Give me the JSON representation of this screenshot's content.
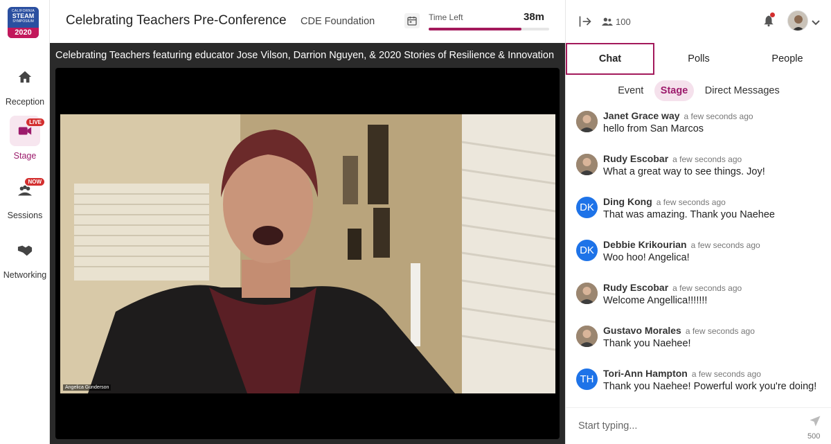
{
  "nav": {
    "logo": {
      "line1": "CALIFORNIA",
      "line2": "STEAM",
      "line3": "SYMPOSIUM",
      "year": "2020"
    },
    "items": [
      {
        "label": "Reception",
        "icon": "home-icon",
        "badge": ""
      },
      {
        "label": "Stage",
        "icon": "video-camera-icon",
        "badge": "LIVE"
      },
      {
        "label": "Sessions",
        "icon": "sessions-icon",
        "badge": "NOW"
      },
      {
        "label": "Networking",
        "icon": "handshake-icon",
        "badge": ""
      }
    ]
  },
  "header": {
    "title": "Celebrating Teachers Pre-Conference",
    "organizer": "CDE Foundation",
    "time_left_label": "Time Left",
    "time_left_value": "38m",
    "time_progress_pct": 77
  },
  "stage": {
    "title": "Celebrating Teachers featuring educator Jose Vilson, Darrion Nguyen, & 2020 Stories of Resilience & Innovation",
    "speaker_name": "Angelica Gunderson"
  },
  "topbar": {
    "attendee_count": "100"
  },
  "tabs": [
    {
      "label": "Chat",
      "active": true
    },
    {
      "label": "Polls",
      "active": false
    },
    {
      "label": "People",
      "active": false
    }
  ],
  "subtabs": [
    {
      "label": "Event",
      "active": false
    },
    {
      "label": "Stage",
      "active": true
    },
    {
      "label": "Direct Messages",
      "active": false
    }
  ],
  "messages": [
    {
      "name": "Janet Grace way",
      "time": "a few seconds ago",
      "text": "hello from San Marcos",
      "avatar": "photo",
      "initials": ""
    },
    {
      "name": "Rudy Escobar",
      "time": "a few seconds ago",
      "text": "What a great way to see things. Joy!",
      "avatar": "photo",
      "initials": ""
    },
    {
      "name": "Ding Kong",
      "time": "a few seconds ago",
      "text": "That was amazing. Thank you Naehee",
      "avatar": "initials",
      "initials": "DK"
    },
    {
      "name": "Debbie Krikourian",
      "time": "a few seconds ago",
      "text": "Woo hoo! Angelica!",
      "avatar": "initials",
      "initials": "DK"
    },
    {
      "name": "Rudy Escobar",
      "time": "a few seconds ago",
      "text": "Welcome Angellica!!!!!!!",
      "avatar": "photo",
      "initials": ""
    },
    {
      "name": "Gustavo Morales",
      "time": "a few seconds ago",
      "text": "Thank you Naehee!",
      "avatar": "photo",
      "initials": ""
    },
    {
      "name": "Tori-Ann Hampton",
      "time": "a few seconds ago",
      "text": "Thank you Naehee! Powerful work you're doing!",
      "avatar": "initials",
      "initials": "TH"
    }
  ],
  "composer": {
    "placeholder": "Start typing...",
    "char_limit": "500"
  },
  "colors": {
    "accent": "#a3195b",
    "accent_light": "#f5e1ec",
    "initials_avatar": "#1e73e8",
    "live_badge": "#d32f2f"
  }
}
